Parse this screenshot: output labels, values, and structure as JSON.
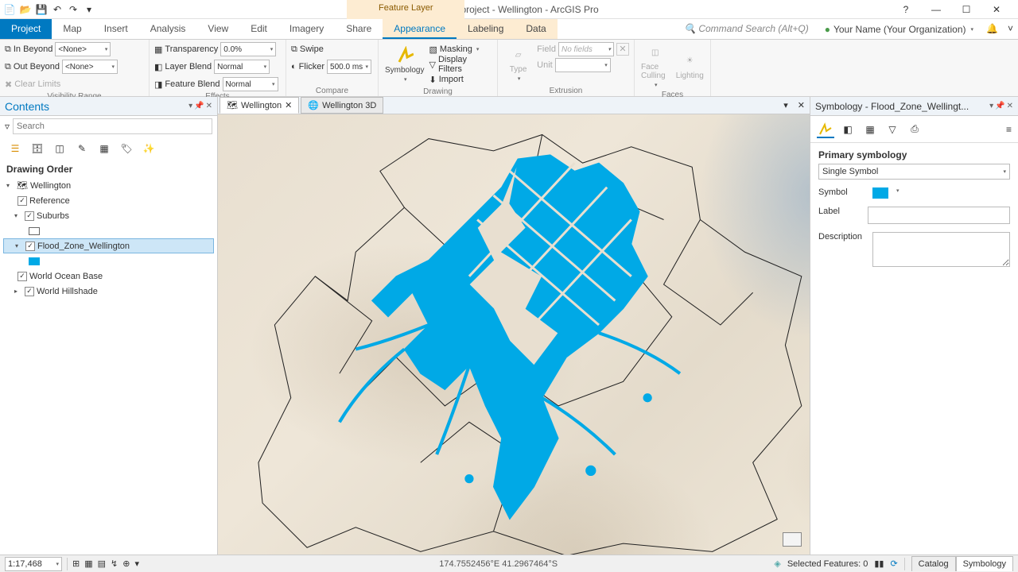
{
  "title": "Add_data_to_a_project - Wellington - ArcGIS Pro",
  "context_tab": "Feature Layer",
  "command_search_placeholder": "Command Search (Alt+Q)",
  "user_label": "Your Name (Your Organization)",
  "tabs": {
    "project": "Project",
    "map": "Map",
    "insert": "Insert",
    "analysis": "Analysis",
    "view": "View",
    "edit": "Edit",
    "imagery": "Imagery",
    "share": "Share",
    "appearance": "Appearance",
    "labeling": "Labeling",
    "data": "Data"
  },
  "ribbon": {
    "visibility": {
      "in_beyond": "In Beyond",
      "out_beyond": "Out Beyond",
      "clear_limits": "Clear Limits",
      "none": "<None>",
      "group": "Visibility Range"
    },
    "effects": {
      "transparency": "Transparency",
      "transparency_val": "0.0%",
      "layer_blend": "Layer Blend",
      "feature_blend": "Feature Blend",
      "normal": "Normal",
      "group": "Effects"
    },
    "compare": {
      "swipe": "Swipe",
      "flicker": "Flicker",
      "flicker_val": "500.0  ms",
      "group": "Compare"
    },
    "drawing": {
      "symbology": "Symbology",
      "masking": "Masking",
      "display_filters": "Display Filters",
      "import": "Import",
      "group": "Drawing"
    },
    "extrusion": {
      "type": "Type",
      "unit": "Unit",
      "field": "Field",
      "no_fields": "No fields",
      "group": "Extrusion"
    },
    "faces": {
      "face_culling": "Face Culling",
      "lighting": "Lighting",
      "group": "Faces"
    }
  },
  "contents": {
    "title": "Contents",
    "search_placeholder": "Search",
    "drawing_order": "Drawing Order",
    "tree": {
      "map": "Wellington",
      "reference": "Reference",
      "suburbs": "Suburbs",
      "flood": "Flood_Zone_Wellington",
      "ocean": "World Ocean Base",
      "hillshade": "World Hillshade"
    }
  },
  "map_tabs": {
    "wellington": "Wellington",
    "wellington3d": "Wellington 3D"
  },
  "symbology_pane": {
    "title": "Symbology - Flood_Zone_Wellingt...",
    "primary": "Primary symbology",
    "single_symbol": "Single Symbol",
    "symbol": "Symbol",
    "label": "Label",
    "description": "Description"
  },
  "status": {
    "scale": "1:17,468",
    "coords": "174.7552456°E 41.2967464°S",
    "selected": "Selected Features: 0",
    "catalog": "Catalog",
    "symbology": "Symbology"
  },
  "colors": {
    "accent": "#0079c1",
    "flood": "#00a9e6"
  }
}
